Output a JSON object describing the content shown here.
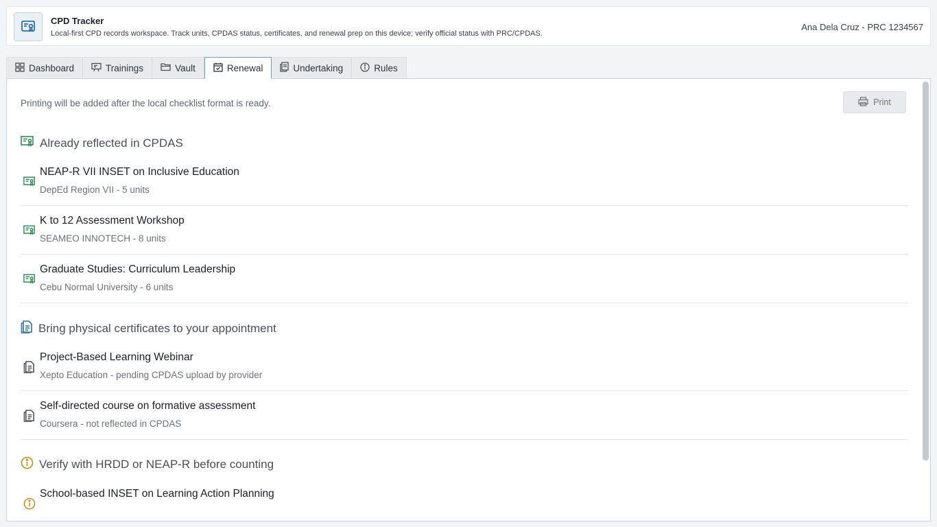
{
  "header": {
    "title": "CPD Tracker",
    "subtitle": "Local-first CPD records workspace. Track units, CPDAS status, certificates, and renewal prep on this device; verify official status with PRC/CPDAS.",
    "user": "Ana Dela Cruz - PRC 1234567",
    "icon": "certificate-icon"
  },
  "tabs": [
    {
      "label": "Dashboard",
      "icon": "grid-icon"
    },
    {
      "label": "Trainings",
      "icon": "presentation-icon"
    },
    {
      "label": "Vault",
      "icon": "folder-icon"
    },
    {
      "label": "Renewal",
      "icon": "calendar-check-icon",
      "active": true
    },
    {
      "label": "Undertaking",
      "icon": "documents-icon"
    },
    {
      "label": "Rules",
      "icon": "info-icon"
    }
  ],
  "renewal": {
    "note": "Printing will be added after the local checklist format is ready.",
    "print_label": "Print",
    "sections": [
      {
        "heading": "Already reflected in CPDAS",
        "icon": "certificate-check-icon",
        "color": "#2e8b57",
        "items": [
          {
            "title": "NEAP-R VII INSET on Inclusive Education",
            "sub": "DepEd Region VII - 5 units"
          },
          {
            "title": "K to 12 Assessment Workshop",
            "sub": "SEAMEO INNOTECH - 8 units"
          },
          {
            "title": "Graduate Studies: Curriculum Leadership",
            "sub": "Cebu Normal University - 6 units"
          }
        ]
      },
      {
        "heading": "Bring physical certificates to your appointment",
        "icon": "document-icon",
        "color": "#2f6fa8",
        "items": [
          {
            "title": "Project-Based Learning Webinar",
            "sub": "Xepto Education - pending CPDAS upload by provider"
          },
          {
            "title": "Self-directed course on formative assessment",
            "sub": "Coursera - not reflected in CPDAS"
          }
        ]
      },
      {
        "heading": "Verify with HRDD or NEAP-R before counting",
        "icon": "info-circle-icon",
        "color": "#c98a16",
        "items": [
          {
            "title": "School-based INSET on Learning Action Planning",
            "sub": ""
          }
        ]
      }
    ]
  },
  "colors": {
    "accent": "#2f6fa8",
    "success": "#2e8b57",
    "warning": "#c98a16"
  }
}
